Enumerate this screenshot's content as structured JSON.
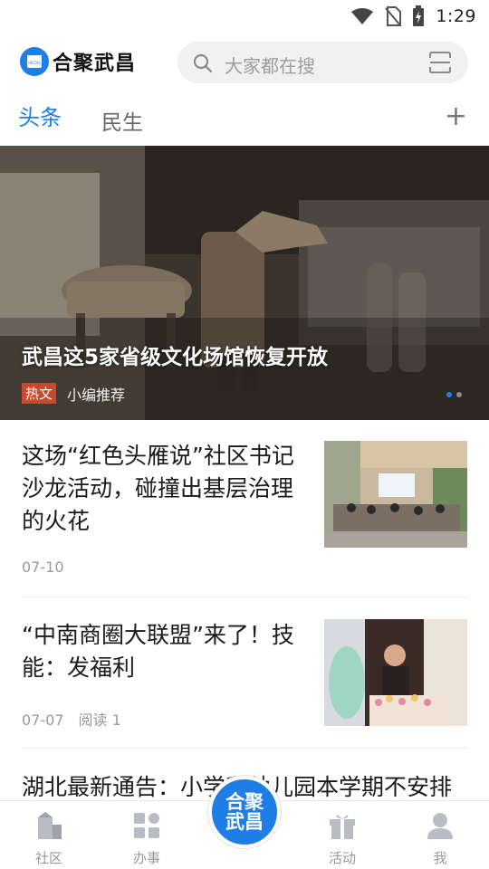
{
  "status_bar": {
    "time": "1:29"
  },
  "header": {
    "app_name": "合聚武昌",
    "logo_badge": "HECHS",
    "search_placeholder": "大家都在搜"
  },
  "tabs": [
    {
      "label": "头条",
      "active": true
    },
    {
      "label": "民生",
      "active": false
    }
  ],
  "tab_add_label": "+",
  "hero": {
    "title": "武昌这5家省级文化场馆恢复开放",
    "tag": "热文",
    "source": "小编推荐",
    "slide_count": 2,
    "active_slide": 1
  },
  "news": [
    {
      "title": "这场“红色头雁说”社区书记沙龙活动，碰撞出基层治理的火花",
      "date": "07-10",
      "reads": ""
    },
    {
      "title": "“中南商圈大联盟”来了！技能：发福利",
      "date": "07-07",
      "reads": "阅读 1"
    }
  ],
  "partial_news_title": "湖北最新通告：小学和幼儿园本学期不安排",
  "bottom_nav": {
    "items": [
      {
        "label": "社区",
        "icon": "building-icon"
      },
      {
        "label": "办事",
        "icon": "apps-grid-icon"
      },
      {
        "label": "活动",
        "icon": "gift-icon"
      },
      {
        "label": "我",
        "icon": "user-icon"
      }
    ],
    "center_line1": "合聚",
    "center_line2": "武昌"
  },
  "colors": {
    "accent": "#1f7de6",
    "tag_red": "#c84a2e"
  }
}
